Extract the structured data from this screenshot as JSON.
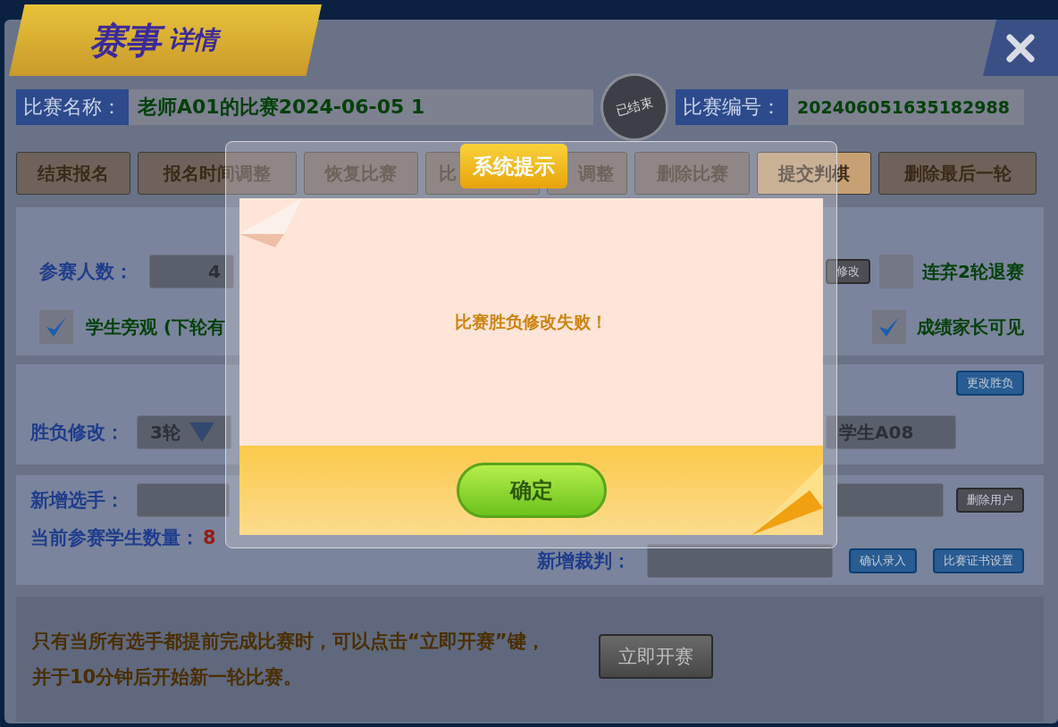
{
  "window": {
    "title_main": "赛事",
    "title_sub": "详情"
  },
  "status_stamp": "已结束",
  "info": [
    {
      "label": "比赛名称：",
      "value": "老师A01的比赛2024-06-05 1"
    },
    {
      "label": "比赛编号：",
      "value": "202406051635182988"
    }
  ],
  "toolbar": [
    {
      "label": "结束报名",
      "highlighted": false
    },
    {
      "label": "报名时间调整",
      "highlighted": false
    },
    {
      "label": "恢复比赛",
      "highlighted": false
    },
    {
      "label": "比",
      "highlighted": false
    },
    {
      "label": "调整",
      "highlighted": false
    },
    {
      "label": "删除比赛",
      "highlighted": false
    },
    {
      "label": "提交判棋",
      "highlighted": true
    },
    {
      "label": "删除最后一轮",
      "highlighted": false
    }
  ],
  "settings": {
    "players_label": "参赛人数：",
    "players_value": "4",
    "edit_button": "修改",
    "options": [
      {
        "label": "连弃2轮退赛",
        "checked": false
      },
      {
        "label": "学生旁观 (下轮有",
        "checked": true
      },
      {
        "label": "成绩家长可见",
        "checked": true
      }
    ]
  },
  "results": {
    "change_button": "更改胜负",
    "label": "胜负修改：",
    "round": "3轮",
    "player": "学生A08"
  },
  "roster": {
    "add_label": "新增选手：",
    "delete_button": "删除用户",
    "count_label": "当前参赛学生数量：",
    "count": "8",
    "referee_label": "新增裁判：",
    "confirm_button": "确认录入",
    "certificate_button": "比赛证书设置"
  },
  "notice": {
    "lines": [
      "只有当所有选手都提前完成比赛时，可以点击“立即开赛”键，",
      "并于10分钟后开始新一轮比赛。"
    ],
    "start_button": "立即开赛"
  },
  "dialog": {
    "title": "系统提示",
    "message": "比赛胜负修改失败！",
    "ok_button": "确定"
  }
}
